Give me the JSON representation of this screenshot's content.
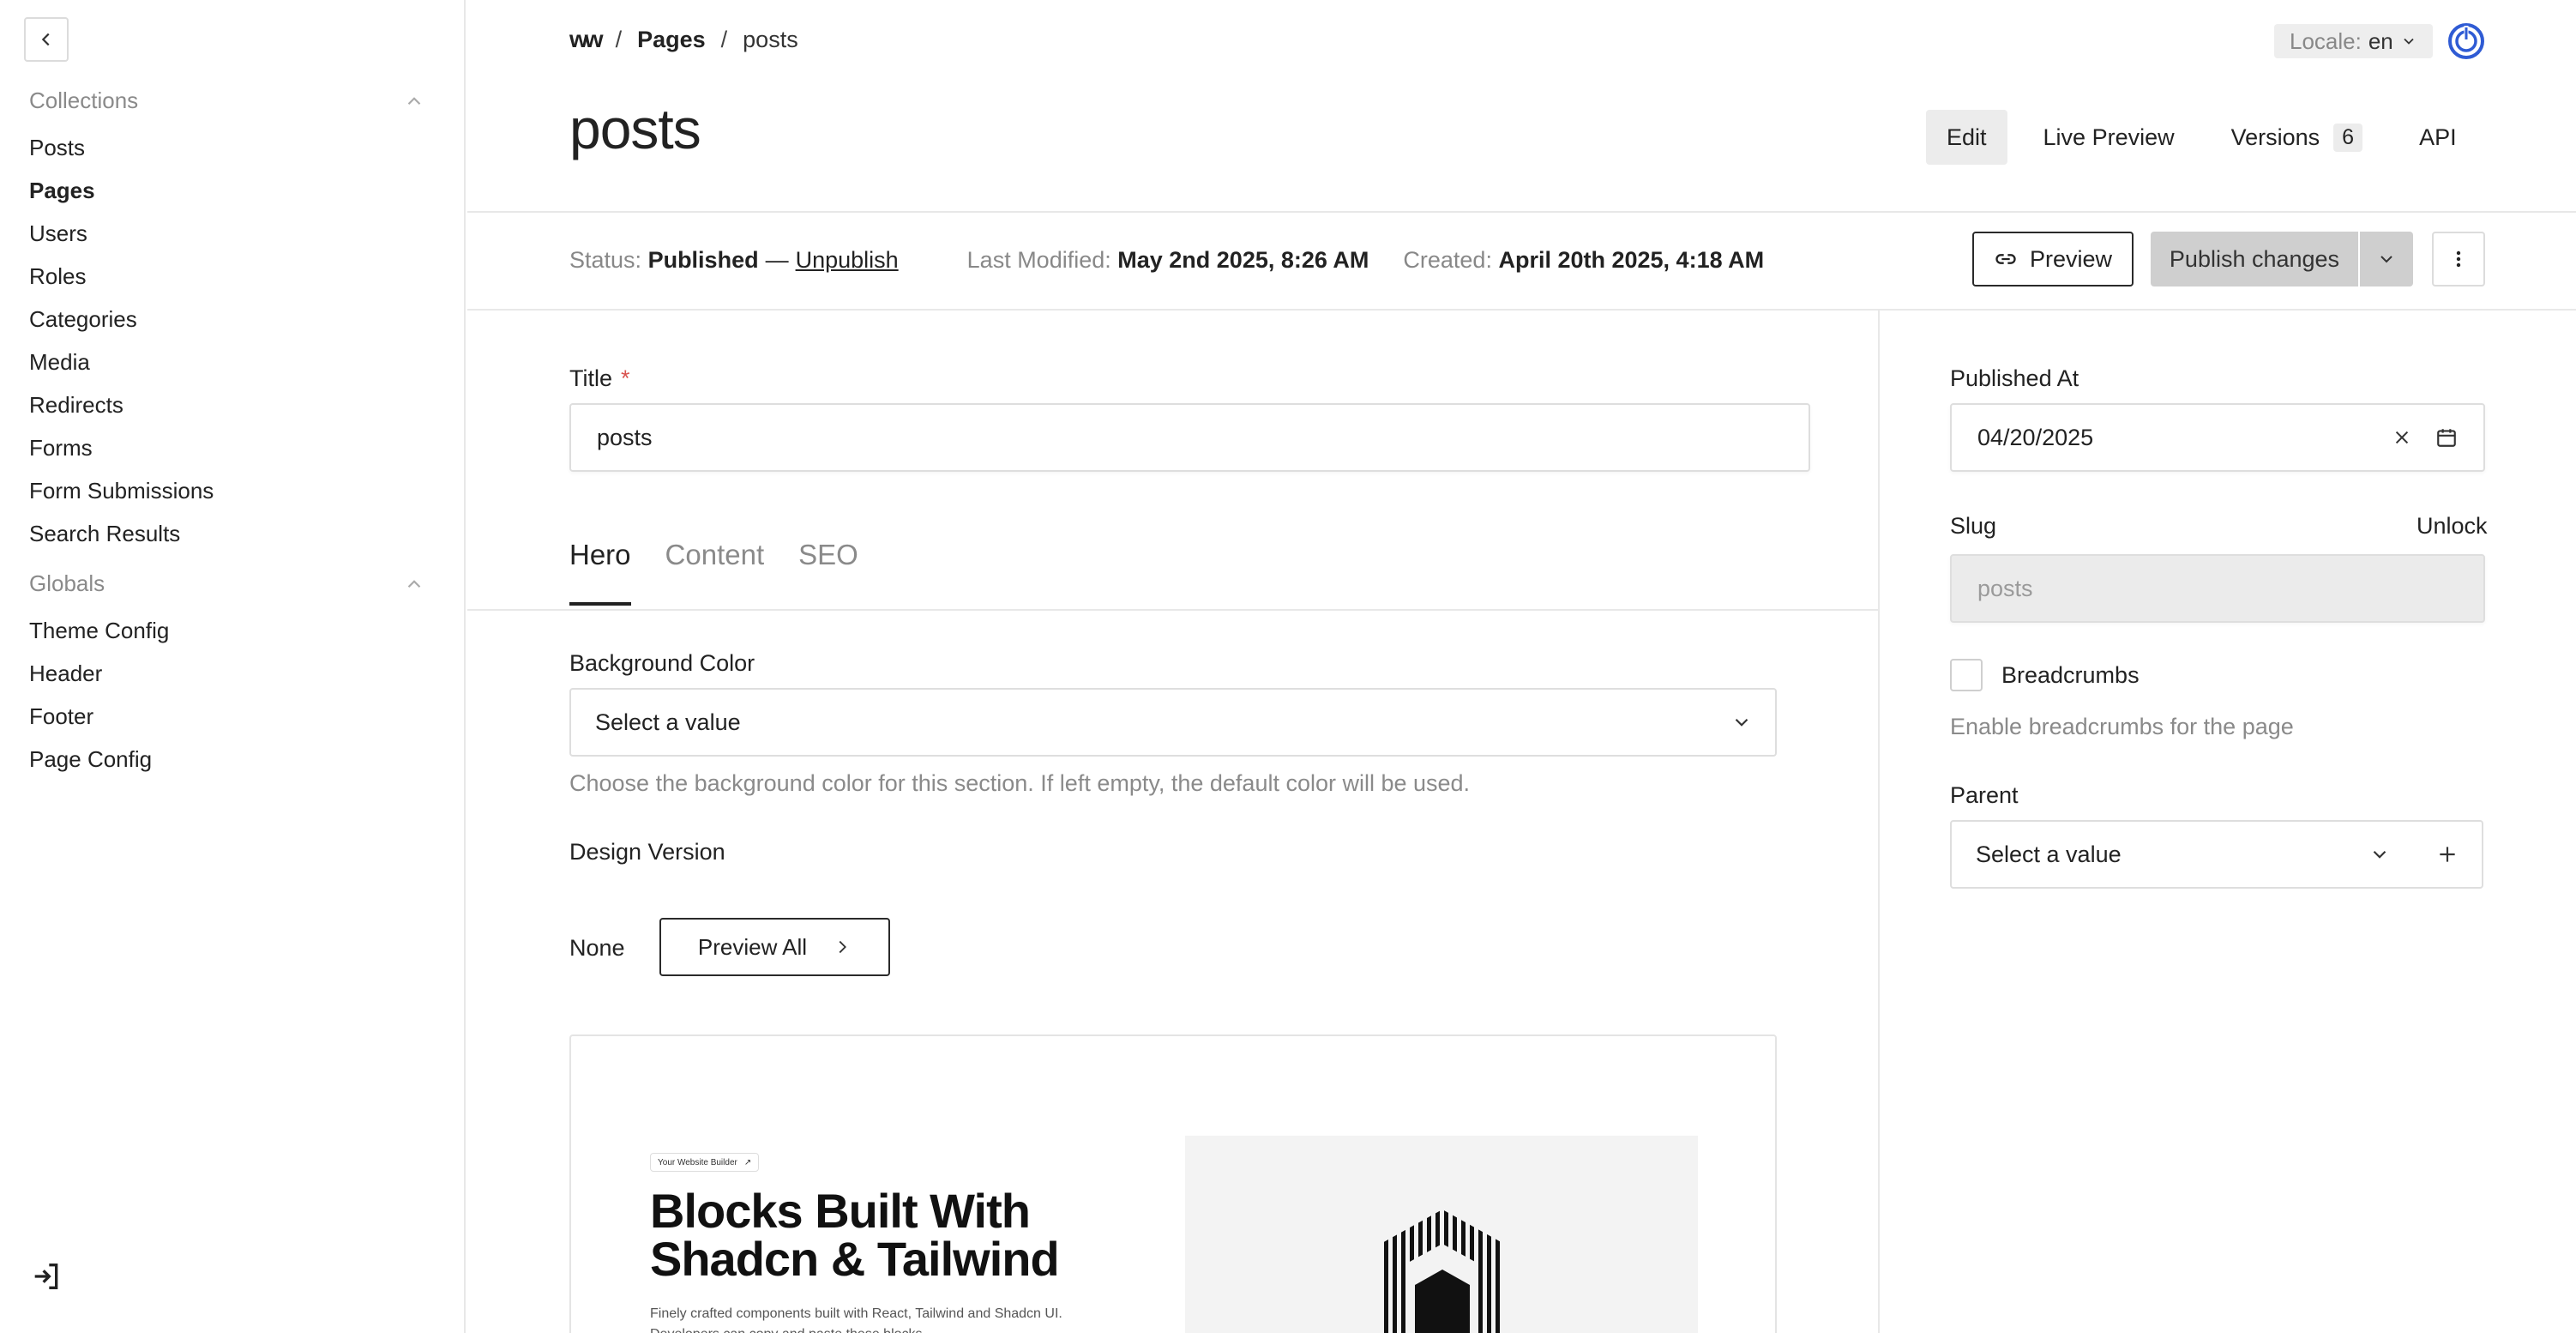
{
  "sidebar": {
    "groups": [
      {
        "label": "Collections",
        "items": [
          "Posts",
          "Pages",
          "Users",
          "Roles",
          "Categories",
          "Media",
          "Redirects",
          "Forms",
          "Form Submissions",
          "Search Results"
        ]
      },
      {
        "label": "Globals",
        "items": [
          "Theme Config",
          "Header",
          "Footer",
          "Page Config"
        ]
      }
    ],
    "active_item": "Pages"
  },
  "breadcrumb": {
    "logo_text": "w",
    "sep": "/",
    "parent": "Pages",
    "current": "posts"
  },
  "locale": {
    "label": "Locale:",
    "value": "en"
  },
  "document": {
    "title": "posts"
  },
  "view_tabs": {
    "edit": "Edit",
    "live_preview": "Live Preview",
    "versions": "Versions",
    "versions_count": "6",
    "api": "API"
  },
  "status": {
    "status_label": "Status:",
    "status_value": "Published",
    "dash": "—",
    "unpublish": "Unpublish",
    "modified_label": "Last Modified:",
    "modified_value": "May 2nd 2025, 8:26 AM",
    "created_label": "Created:",
    "created_value": "April 20th 2025, 4:18 AM"
  },
  "actions": {
    "preview": "Preview",
    "publish": "Publish changes"
  },
  "form": {
    "title_label": "Title",
    "required_mark": "*",
    "title_value": "posts",
    "tabs": [
      "Hero",
      "Content",
      "SEO"
    ],
    "bg_color_label": "Background Color",
    "bg_color_placeholder": "Select a value",
    "bg_color_hint": "Choose the background color for this section. If left empty, the default color will be used.",
    "design_version_label": "Design Version",
    "design_version_value": "None",
    "preview_all": "Preview All"
  },
  "preview_card": {
    "badge": "Your Website Builder",
    "headline_1": "Blocks Built With",
    "headline_2": "Shadcn & Tailwind",
    "description": "Finely crafted components built with React, Tailwind and Shadcn UI. Developers can copy and paste these blocks"
  },
  "sidebar_fields": {
    "published_at_label": "Published At",
    "published_at_value": "04/20/2025",
    "slug_label": "Slug",
    "slug_unlock": "Unlock",
    "slug_value": "posts",
    "breadcrumbs_label": "Breadcrumbs",
    "breadcrumbs_hint": "Enable breadcrumbs for the page",
    "parent_label": "Parent",
    "parent_placeholder": "Select a value"
  },
  "colors": {
    "accent_account": "#2f5bd4",
    "publish_bg": "#cfcfcf",
    "required": "#d9534f"
  }
}
